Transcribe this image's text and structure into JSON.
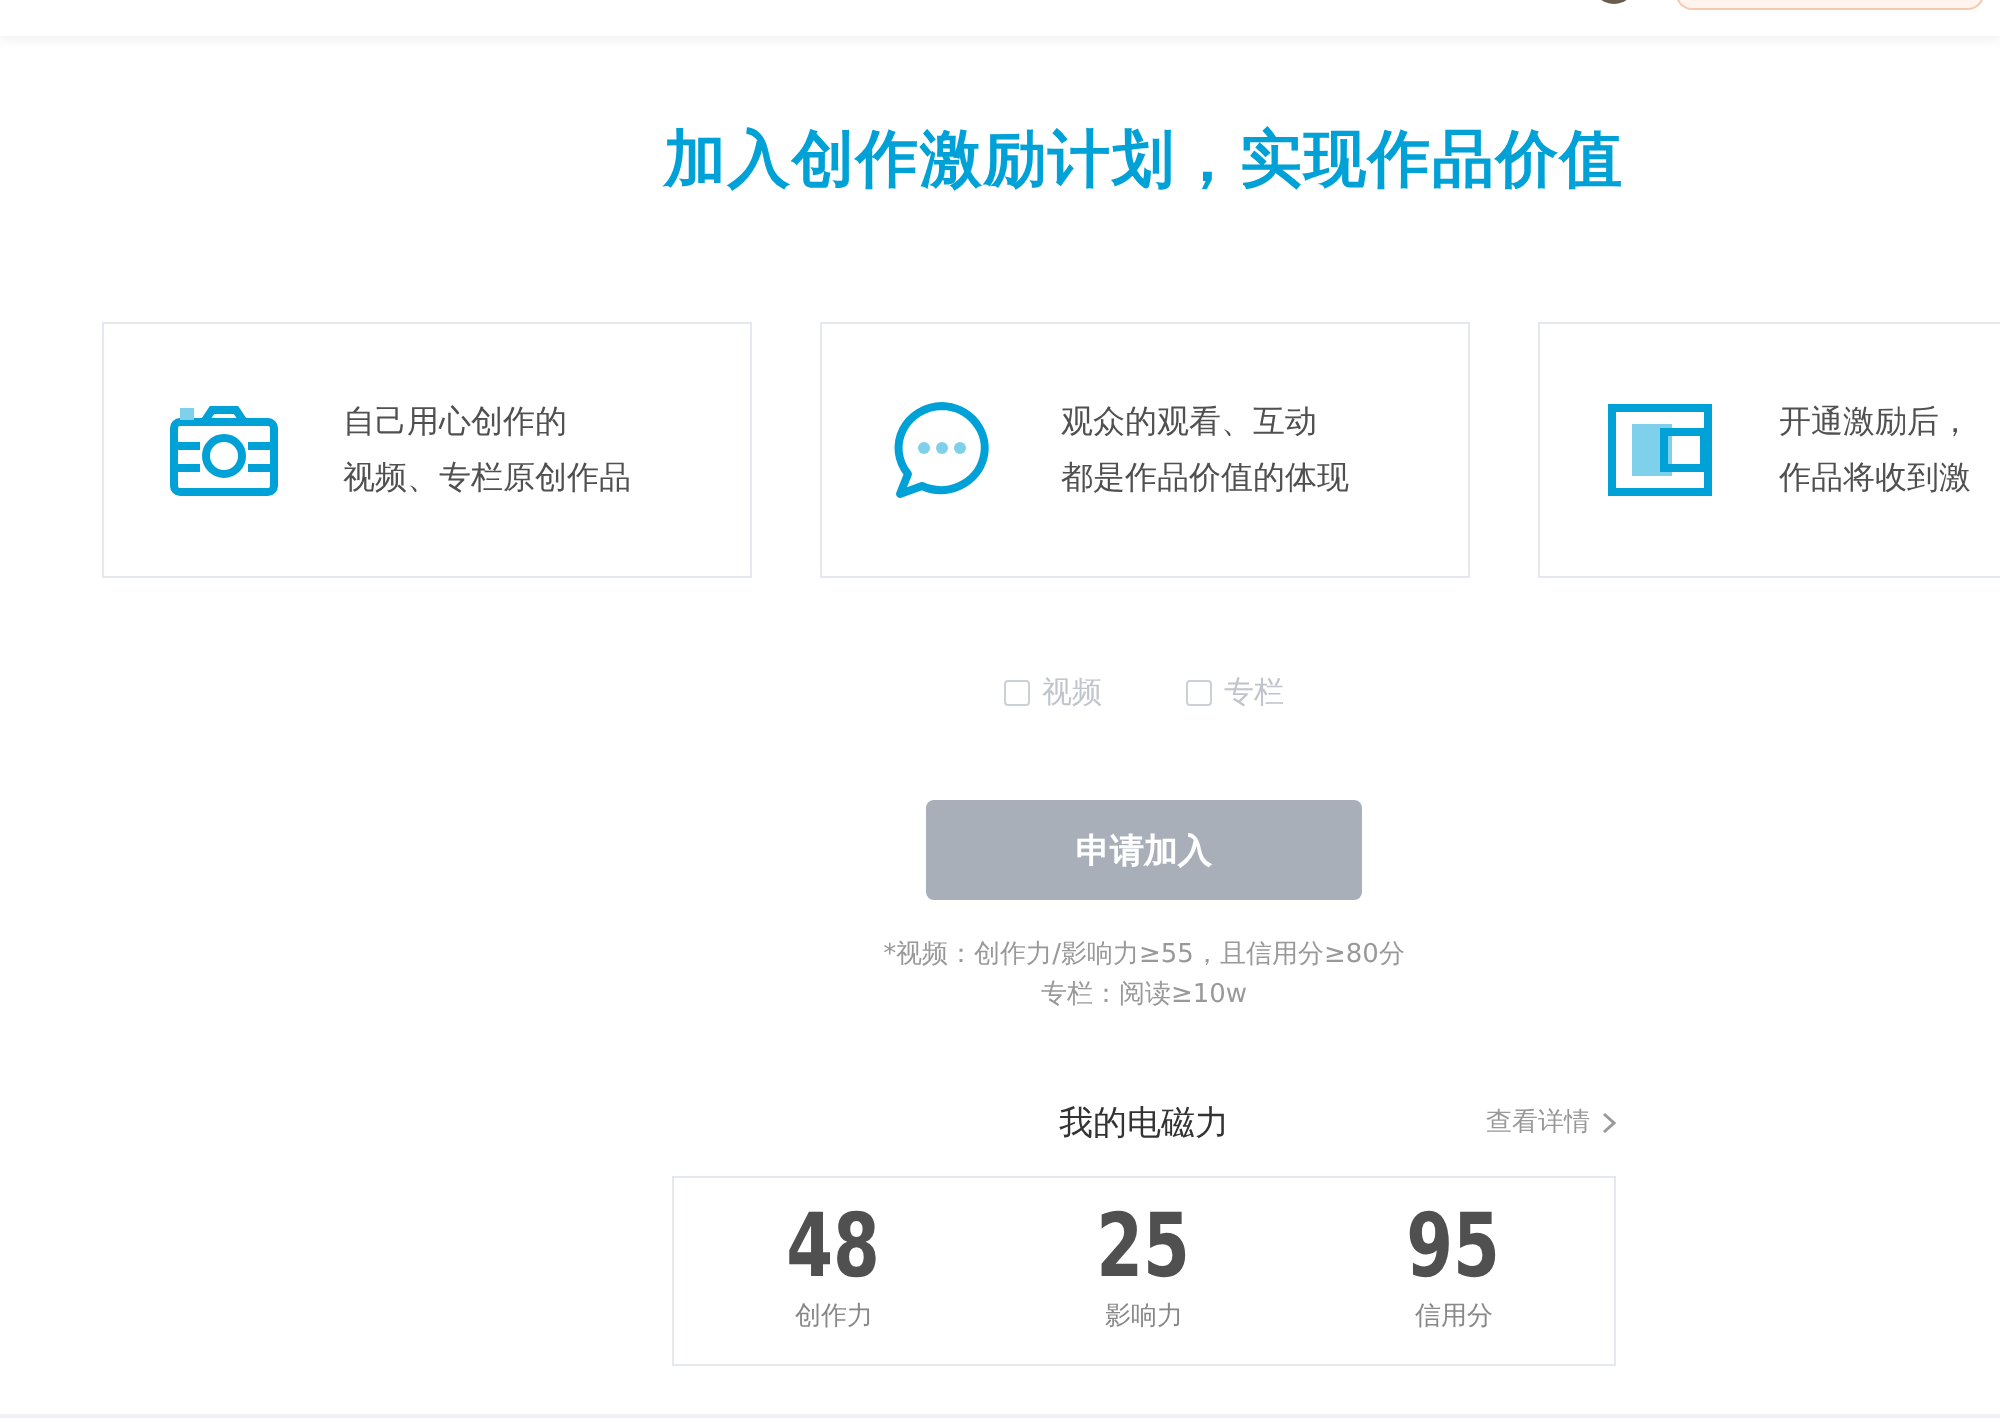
{
  "title": "加入创作激励计划，实现作品价值",
  "cards": [
    {
      "kind": "camera",
      "lines": [
        "自己用心创作的",
        "视频、专栏原创作品"
      ]
    },
    {
      "kind": "chat",
      "lines": [
        "观众的观看、互动",
        "都是作品价值的体现"
      ]
    },
    {
      "kind": "wallet",
      "lines": [
        "开通激励后，",
        "作品将收到激"
      ]
    }
  ],
  "options": [
    {
      "label": "视频",
      "checked": false
    },
    {
      "label": "专栏",
      "checked": false
    }
  ],
  "apply_button": {
    "label": "申请加入",
    "disabled": true
  },
  "requirements": [
    "*视频：创作力/影响力≥55，且信用分≥80分",
    "专栏：阅读≥10w"
  ],
  "stats": {
    "title": "我的电磁力",
    "details_link": "查看详情",
    "items": [
      {
        "value": "48",
        "label": "创作力"
      },
      {
        "value": "25",
        "label": "影响力"
      },
      {
        "value": "95",
        "label": "信用分"
      }
    ]
  }
}
